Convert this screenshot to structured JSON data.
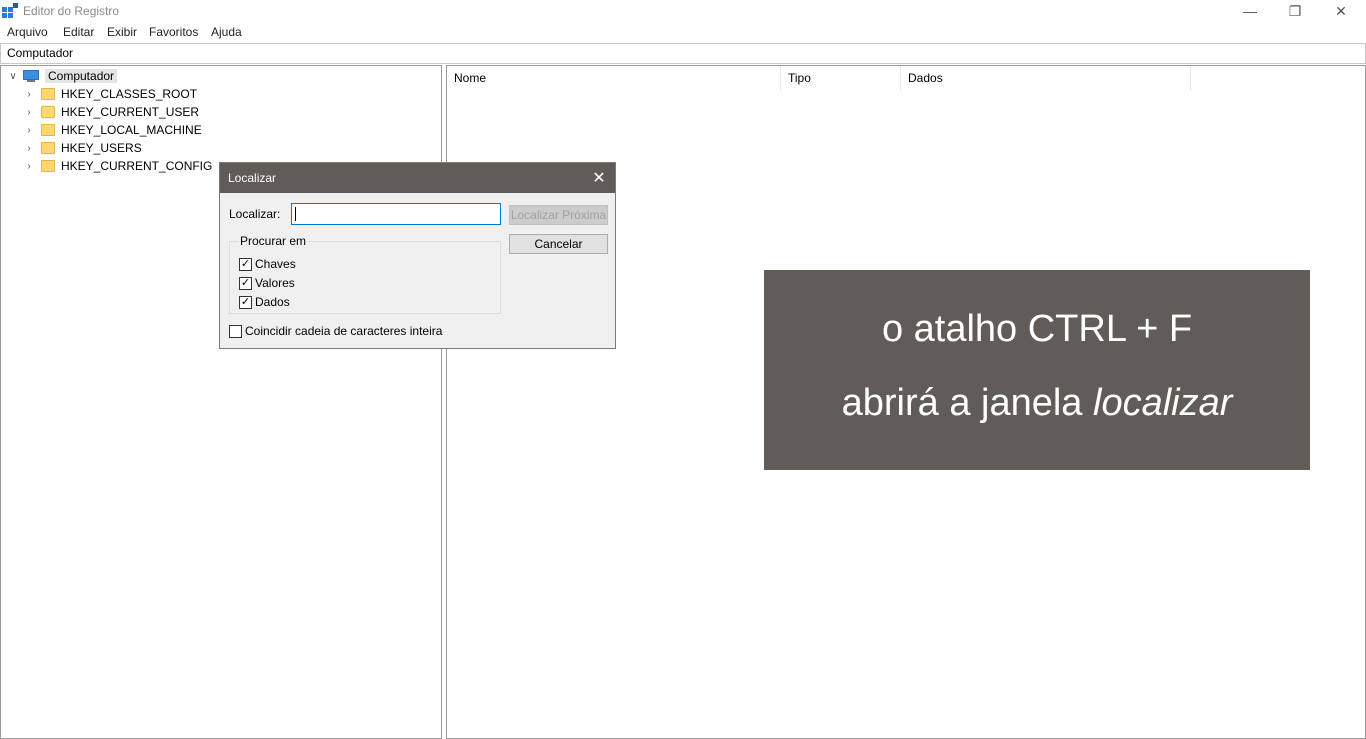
{
  "window": {
    "title": "Editor do Registro",
    "minimize_glyph": "—",
    "restore_glyph": "❐",
    "close_glyph": "✕"
  },
  "menu": [
    "Arquivo",
    "Editar",
    "Exibir",
    "Favoritos",
    "Ajuda"
  ],
  "address": "Computador",
  "tree": {
    "root": "Computador",
    "items": [
      "HKEY_CLASSES_ROOT",
      "HKEY_CURRENT_USER",
      "HKEY_LOCAL_MACHINE",
      "HKEY_USERS",
      "HKEY_CURRENT_CONFIG"
    ]
  },
  "list": {
    "columns": [
      "Nome",
      "Tipo",
      "Dados"
    ]
  },
  "dialog": {
    "title": "Localizar",
    "find_label": "Localizar:",
    "find_value": "",
    "find_next_button": "Localizar Próxima",
    "cancel_button": "Cancelar",
    "group_title": "Procurar em",
    "options": [
      {
        "label": "Chaves",
        "checked": true
      },
      {
        "label": "Valores",
        "checked": true
      },
      {
        "label": "Dados",
        "checked": true
      }
    ],
    "match_whole": {
      "label": "Coincidir cadeia de caracteres inteira",
      "checked": false
    }
  },
  "banner": {
    "line1": "o atalho CTRL + F",
    "line2_prefix": "abrirá a janela ",
    "line2_emphasis": "localizar"
  },
  "colors": {
    "dialog_title_bg": "#615c57",
    "banner_bg": "#615c57",
    "selection_bg": "#e5e5e5"
  }
}
